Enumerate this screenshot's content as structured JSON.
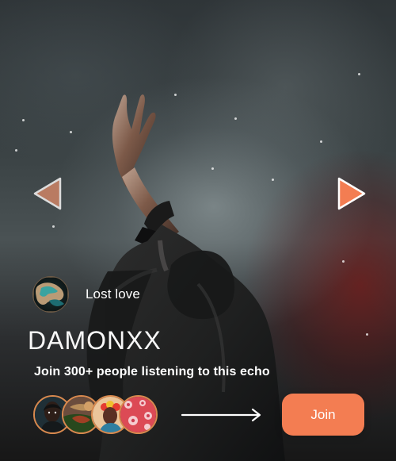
{
  "theme": {
    "accent": "#f37d52",
    "text": "#ffffff"
  },
  "navigation": {
    "previous_icon": "triangle-left-icon",
    "next_icon": "triangle-right-icon"
  },
  "track": {
    "cover_icon": "album-cover",
    "title": "Lost love"
  },
  "artist": {
    "name": "DAMONXX"
  },
  "listeners": {
    "message": "Join 300+ people listening to this echo",
    "avatar_icons": [
      "listener-avatar-1",
      "listener-avatar-2",
      "listener-avatar-3",
      "listener-avatar-4"
    ]
  },
  "actions": {
    "arrow_icon": "long-right-arrow-icon",
    "join_label": "Join"
  }
}
